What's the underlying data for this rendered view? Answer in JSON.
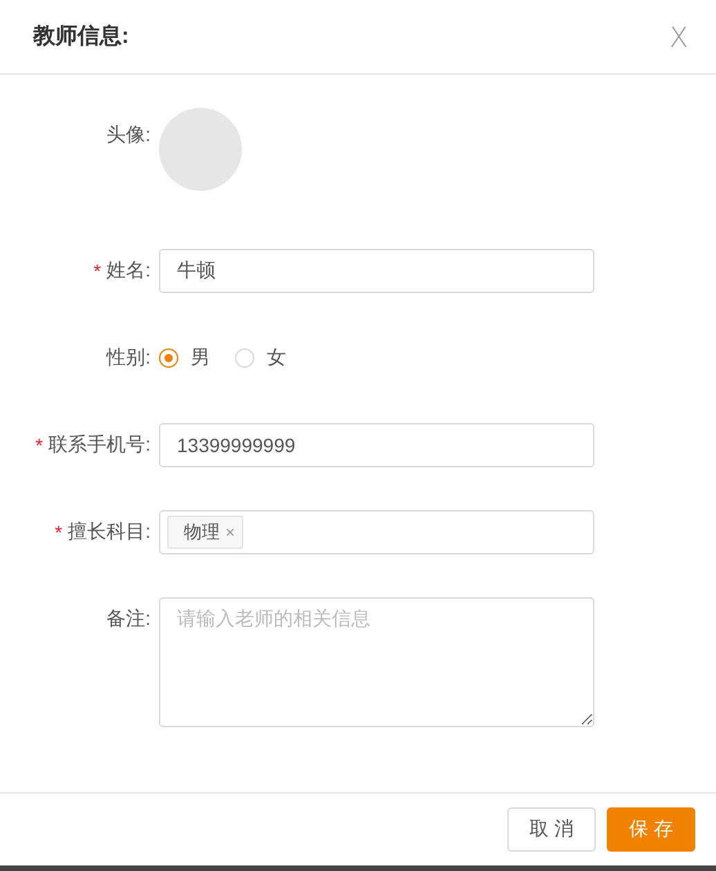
{
  "dialog": {
    "title": "教师信息:",
    "close": "X"
  },
  "fields": [
    {
      "kind": "avatar",
      "label": "头像:"
    },
    {
      "kind": "text",
      "label": "姓名:",
      "required_mark": "*",
      "value": "牛顿"
    },
    {
      "kind": "radio",
      "label": "性别:",
      "options": [
        {
          "label": "男",
          "selected": true
        },
        {
          "label": "女",
          "selected": false
        }
      ]
    },
    {
      "kind": "text",
      "label": "联系手机号:",
      "required_mark": "*",
      "value": "13399999999"
    },
    {
      "kind": "tags",
      "label": "擅长科目:",
      "required_mark": "*",
      "tags": [
        {
          "label": "物理",
          "remove": "×"
        }
      ]
    },
    {
      "kind": "textarea",
      "label": "备注:",
      "placeholder": "请输入老师的相关信息"
    }
  ],
  "buttons": [
    {
      "label": "取 消",
      "kind": "default"
    },
    {
      "label": "保 存",
      "kind": "primary"
    }
  ]
}
